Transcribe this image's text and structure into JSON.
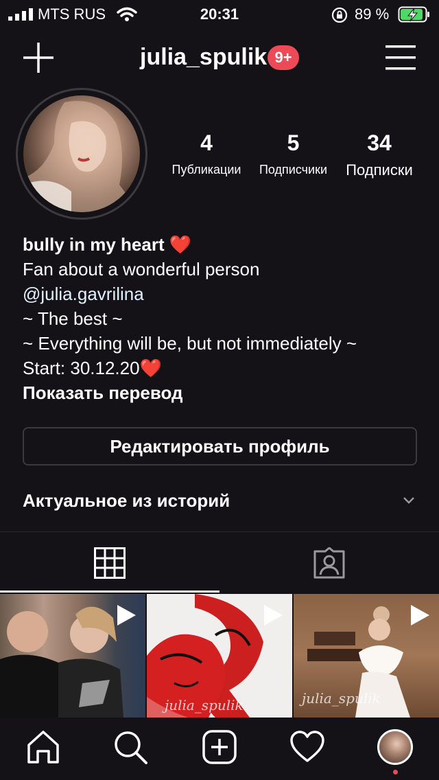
{
  "status_bar": {
    "carrier": "MTS RUS",
    "time": "20:31",
    "battery_percent": "89 %",
    "battery_level": 0.89
  },
  "header": {
    "username": "julia_spulik",
    "notification_badge": "9+",
    "badge_color": "#ed4956"
  },
  "stats": {
    "posts_count": "4",
    "posts_label": "Публикации",
    "followers_count": "5",
    "followers_label": "Подписчики",
    "following_count": "34",
    "following_label": "Подписки"
  },
  "bio": {
    "name": "bully in my heart ❤️",
    "line1": "Fan about a wonderful person",
    "mention": "@julia.gavrilina",
    "line3": "~ The best ~",
    "line4": "~ Everything will be, but not immediately ~",
    "line5": "Start: 30.12.20❤️",
    "show_translation": "Показать перевод"
  },
  "edit_profile_label": "Редактировать профиль",
  "highlights_label": "Актуальное из историй",
  "posts": [
    {
      "type": "video",
      "watermark": ""
    },
    {
      "type": "video",
      "watermark": "julia_spulik"
    },
    {
      "type": "video",
      "watermark": "julia_spulik"
    }
  ],
  "icons": {
    "header_left": "plus-icon",
    "header_right": "hamburger-menu-icon",
    "tabs": [
      "grid-icon",
      "tagged-person-icon"
    ],
    "nav": [
      "home-icon",
      "search-icon",
      "new-post-icon",
      "heart-icon",
      "profile-avatar"
    ]
  }
}
